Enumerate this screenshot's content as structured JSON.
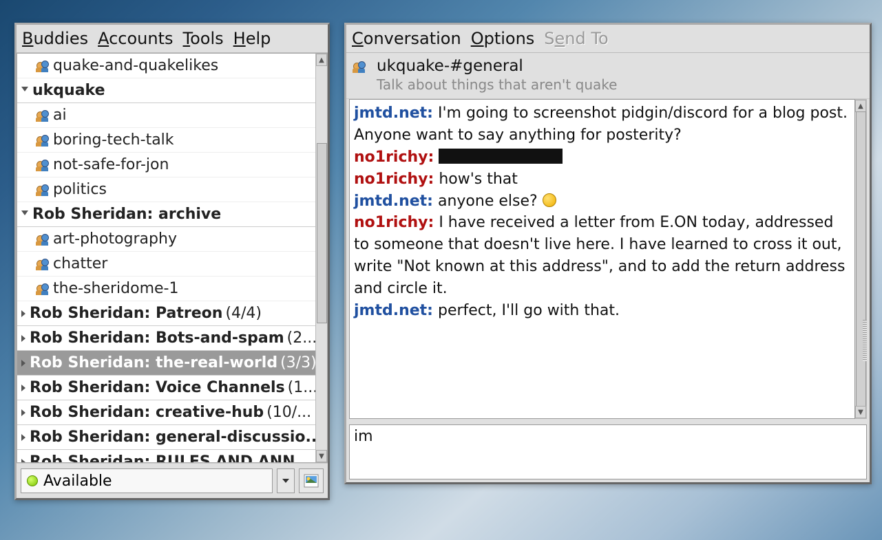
{
  "buddy_window": {
    "menu": [
      "Buddies",
      "Accounts",
      "Tools",
      "Help"
    ],
    "rows": [
      {
        "type": "channel",
        "label": "quake-and-quakelikes"
      },
      {
        "type": "group",
        "label": "ukquake",
        "expanded": true
      },
      {
        "type": "channel",
        "label": "ai"
      },
      {
        "type": "channel",
        "label": "boring-tech-talk"
      },
      {
        "type": "channel",
        "label": "not-safe-for-jon"
      },
      {
        "type": "channel",
        "label": "politics"
      },
      {
        "type": "group",
        "label": "Rob Sheridan: archive",
        "expanded": true
      },
      {
        "type": "channel",
        "label": "art-photography"
      },
      {
        "type": "channel",
        "label": "chatter"
      },
      {
        "type": "channel",
        "label": "the-sheridome-1"
      },
      {
        "type": "group",
        "label": "Rob Sheridan: Patreon",
        "count": "(4/4)",
        "expanded": false
      },
      {
        "type": "group",
        "label": "Rob Sheridan: Bots-and-spam",
        "count": "(2...",
        "expanded": false
      },
      {
        "type": "group",
        "label": "Rob Sheridan: the-real-world",
        "count": "(3/3)",
        "expanded": false,
        "selected": true
      },
      {
        "type": "group",
        "label": "Rob Sheridan: Voice Channels",
        "count": "(1...",
        "expanded": false
      },
      {
        "type": "group",
        "label": "Rob Sheridan: creative-hub",
        "count": "(10/...",
        "expanded": false
      },
      {
        "type": "group",
        "label": "Rob Sheridan: general-discussio...",
        "expanded": false
      },
      {
        "type": "group",
        "label": "Rob Sheridan: RULES AND ANN...",
        "expanded": false
      }
    ],
    "status": "Available"
  },
  "conv_window": {
    "menu": [
      {
        "label": "Conversation",
        "disabled": false
      },
      {
        "label": "Options",
        "disabled": false
      },
      {
        "label": "Send To",
        "disabled": true
      }
    ],
    "title": "ukquake-#general",
    "subtitle": "Talk about things that aren't quake",
    "messages": [
      {
        "nick": "jmtd.net",
        "nclass": "nick-blue",
        "text": "I'm going to screenshot pidgin/discord for a blog post. Anyone want to say anything for posterity?"
      },
      {
        "nick": "no1richy",
        "nclass": "nick-red",
        "redacted": true
      },
      {
        "nick": "no1richy",
        "nclass": "nick-red",
        "text": "how's that"
      },
      {
        "nick": "jmtd.net",
        "nclass": "nick-blue",
        "text": "anyone else?",
        "smiley": true
      },
      {
        "nick": "no1richy",
        "nclass": "nick-red",
        "text": "I have received a letter from E.ON today, addressed to someone that doesn't live here. I have learned to cross it out, write \"Not known at this address\", and to add the return address and circle it."
      },
      {
        "nick": "jmtd.net",
        "nclass": "nick-blue",
        "text": "perfect, I'll go with that."
      }
    ],
    "input_value": "im"
  }
}
